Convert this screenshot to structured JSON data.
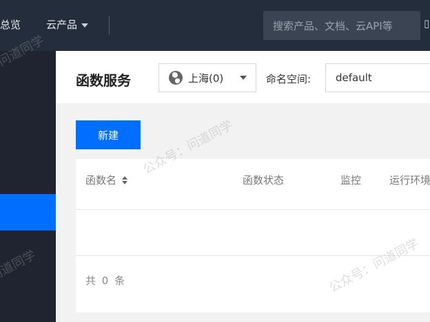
{
  "topbar": {
    "overview_label": "总览",
    "products_label": "云产品",
    "search_placeholder": "搜索产品、文档、云API等",
    "edge_icon": "grid-icon"
  },
  "main": {
    "title": "函数服务",
    "region": "上海(0)",
    "namespace_label": "命名空间:",
    "namespace_value": "default",
    "create_label": "新建"
  },
  "table": {
    "columns": [
      "函数名",
      "函数状态",
      "监控",
      "运行环境"
    ],
    "rows": [],
    "total_text": "共 0 条"
  },
  "watermarks": [
    "公众号：问道同学",
    "问道同学"
  ],
  "colors": {
    "accent": "#006eff",
    "topbar_bg": "#232d3b",
    "sidebar_bg": "#1f2430"
  }
}
